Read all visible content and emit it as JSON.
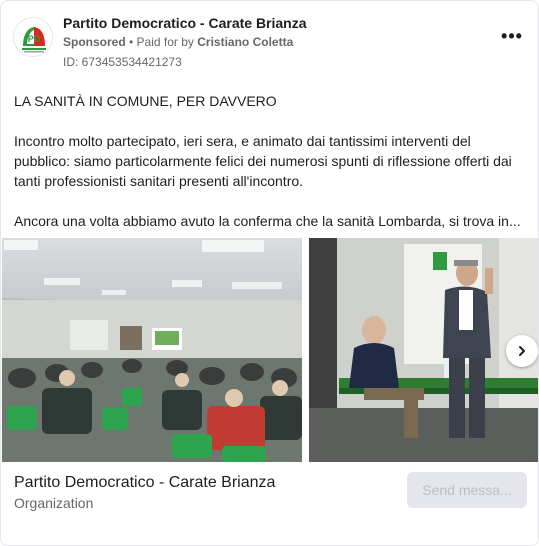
{
  "header": {
    "page_name": "Partito Democratico - Carate Brianza",
    "sponsored": "Sponsored",
    "separator": " • Paid for by ",
    "paid_by": "Cristiano Coletta",
    "ad_id": "ID: 673453534421273",
    "more_label": "•••",
    "avatar_icon": "pd-logo-icon"
  },
  "post": {
    "title": "LA SANITÀ IN COMUNE, PER DAVVERO",
    "paragraph_1": "Incontro molto partecipato, ieri sera, e animato dai tantissimi interventi del pubblico: siamo particolarmente felici dei numerosi spunti di riflessione offerti dai tanti professionisti sanitari presenti all'incontro.",
    "paragraph_2": "Ancora una volta abbiamo avuto la conferma che la sanità Lombarda, si trova in..."
  },
  "carousel": {
    "photos": [
      "audience-photo",
      "speakers-photo"
    ],
    "next_icon": "chevron-right-icon"
  },
  "footer": {
    "title": "Partito Democratico - Carate Brianza",
    "subtitle": "Organization",
    "send_button": "Send messa..."
  },
  "colors": {
    "text_primary": "#1c1e21",
    "text_secondary": "#65676b",
    "button_disabled_bg": "#e4e6eb",
    "button_disabled_text": "#bcc0c4",
    "pd_green": "#2e9a3e",
    "pd_red": "#d52b1e"
  }
}
